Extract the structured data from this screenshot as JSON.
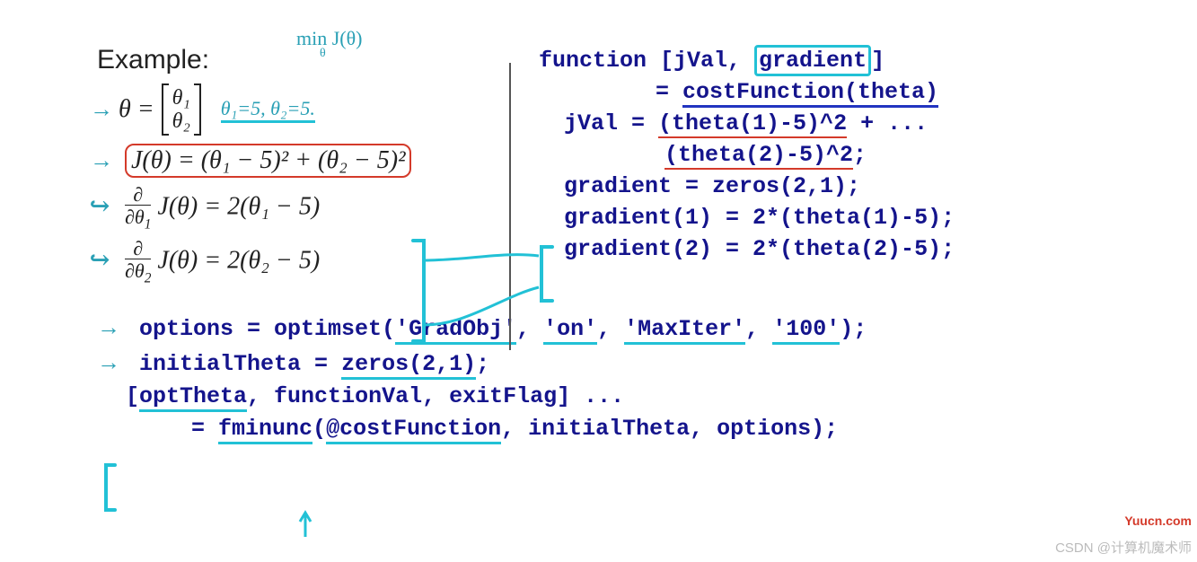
{
  "example": {
    "title": "Example:",
    "minNote": "min J(θ)",
    "minSub": "θ",
    "thetaEq": "θ =",
    "theta1": "θ₁",
    "theta2": "θ₂",
    "paramsNote": "θ₁=5, θ₂=5.",
    "J": "J(θ) = (θ₁ − 5)² + (θ₂ − 5)²",
    "d1Label": "∂/∂θ₁",
    "d1": "J(θ) = 2(θ₁ − 5)",
    "d2Label": "∂/∂θ₂",
    "d2": "J(θ) = 2(θ₂ − 5)"
  },
  "code": {
    "fn1a": "function [jVal, ",
    "fn1grad": "gradient",
    "fn1b": "]",
    "fn2a": "= ",
    "fn2b": "costFunction(theta)",
    "jval1a": "jVal = ",
    "jval1b": "(theta(1)-5)^2",
    "jval1c": " + ...",
    "jval2a": "(theta(2)-5)^2",
    "jval2b": ";",
    "grad0": "gradient = zeros(2,1);",
    "grad1": "gradient(1) = 2*(theta(1)-5);",
    "grad2": "gradient(2) = 2*(theta(2)-5);",
    "opt1a": "options = optimset(",
    "opt1b": "'GradObj'",
    "opt1c": ", ",
    "opt1d": "'on'",
    "opt1e": ", ",
    "opt1f": "'MaxIter'",
    "opt1g": ", ",
    "opt1h": "'100'",
    "opt1i": ");",
    "init1a": "initialTheta = ",
    "init1b": "zeros(2,1)",
    "init1c": ";",
    "call1a": "[",
    "call1b": "optTheta",
    "call1c": ", functionVal, exitFlag] ...",
    "call2a": "= ",
    "call2b": "fminunc",
    "call2c": "(",
    "call2d": "@costFunction",
    "call2e": ", initialTheta, options);"
  },
  "watermark": {
    "source": "Yuucn.com",
    "author": "CSDN @计算机魔术师"
  }
}
